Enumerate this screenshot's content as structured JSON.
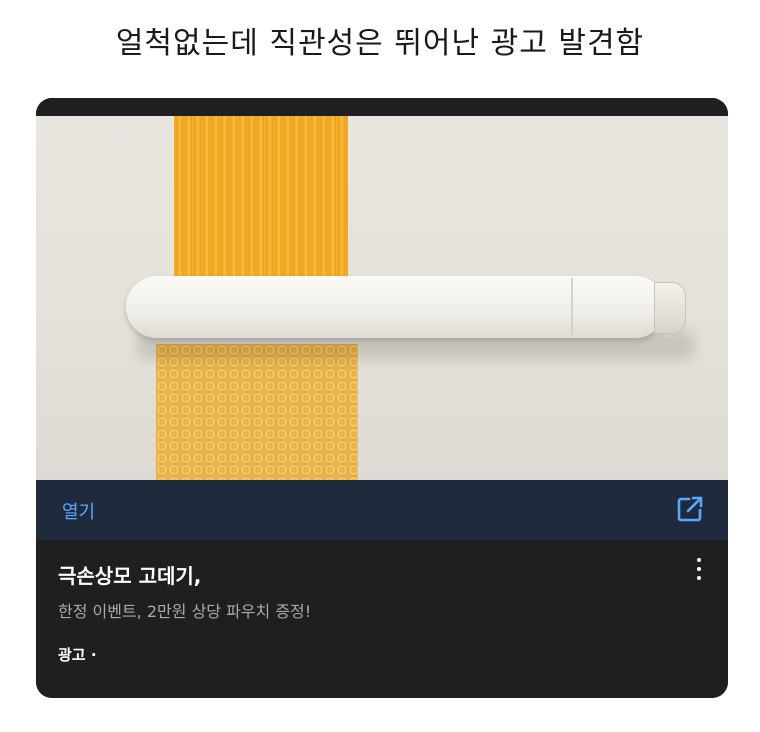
{
  "headline": "얼척없는데 직관성은 뛰어난 광고 발견함",
  "ad_card": {
    "image_alt_icon": "product-photo",
    "open_label": "열기",
    "open_icon": "external-link-icon",
    "title": "극손상모 고데기,",
    "subtitle": "한정 이벤트, 2만원 상당 파우치 증정!",
    "sponsored_label": "광고 ·",
    "more_icon": "more-vertical-icon",
    "colors": {
      "card_bg": "#1f1f21",
      "open_bar_bg": "#1f2b3d",
      "accent": "#5aa7ff"
    }
  }
}
